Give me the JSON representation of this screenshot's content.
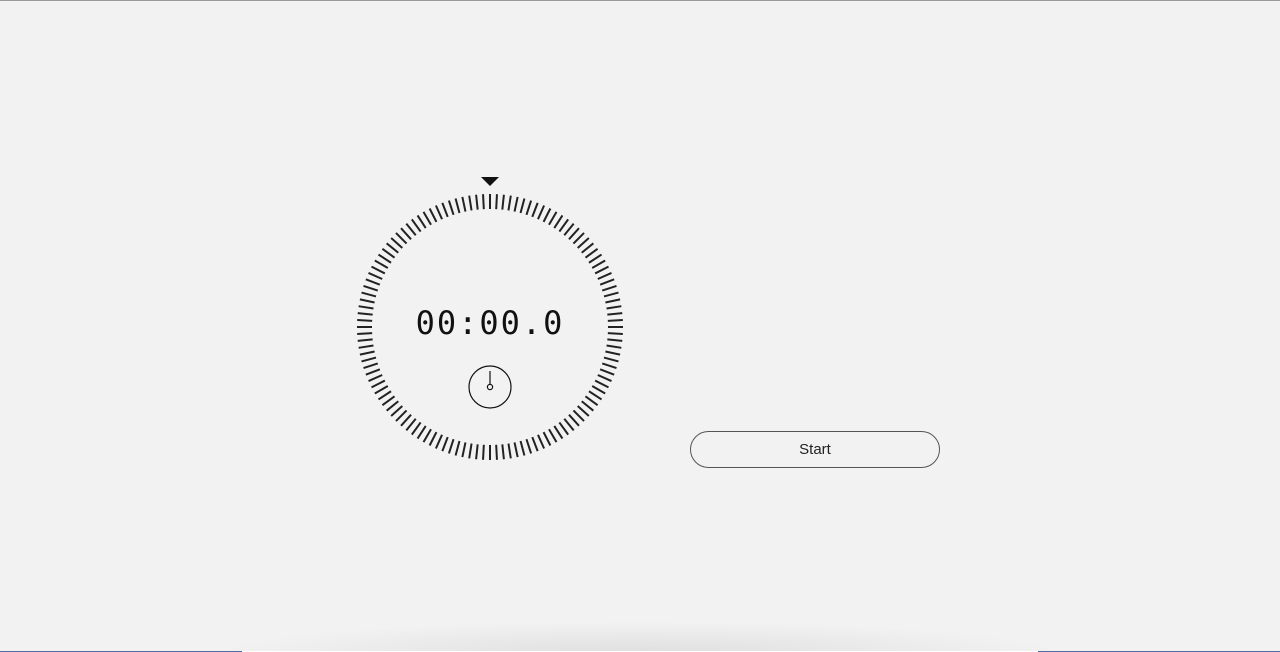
{
  "stopwatch": {
    "time_display": "00:00.0",
    "elapsed_fraction": 0
  },
  "controls": {
    "start_label": "Start"
  },
  "icons": {
    "indicator": "triangle-down-icon",
    "mini_clock": "stopwatch-dial-icon"
  },
  "colors": {
    "background": "#f2f2f2",
    "ink": "#111111"
  }
}
